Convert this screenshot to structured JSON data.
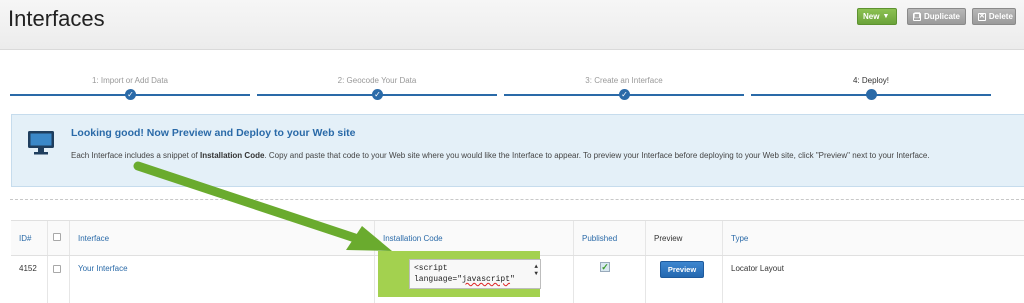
{
  "header": {
    "title": "Interfaces",
    "new_label": "New",
    "duplicate_label": "Duplicate",
    "delete_label": "Delete"
  },
  "steps": [
    {
      "label": "1: Import or Add Data",
      "state": "done"
    },
    {
      "label": "2: Geocode Your Data",
      "state": "done"
    },
    {
      "label": "3: Create an Interface",
      "state": "done"
    },
    {
      "label": "4: Deploy!",
      "state": "current"
    }
  ],
  "info": {
    "title": "Looking good! Now Preview and Deploy to your Web site",
    "body_prefix": "Each Interface includes a snippet of ",
    "body_bold": "Installation Code",
    "body_suffix": ". Copy and paste that code to your Web site where you would like the Interface to appear. To preview your Interface before deploying to your Web site, click \"Preview\" next to your Interface."
  },
  "table": {
    "headers": {
      "id": "ID#",
      "interface": "Interface",
      "installation_code": "Installation Code",
      "published": "Published",
      "preview": "Preview",
      "type": "Type"
    },
    "rows": [
      {
        "id": "4152",
        "interface": "Your Interface",
        "code_line1": "<script",
        "code_line2a": "language=\"",
        "code_line2b": "javascript",
        "code_line2c": "\"",
        "published": true,
        "preview_label": "Preview",
        "type": "Locator Layout"
      }
    ]
  },
  "colors": {
    "accent_blue": "#2a6aa8",
    "new_green": "#7bb342",
    "highlight_green": "#a3d14f",
    "arrow_green": "#6aab2e"
  }
}
